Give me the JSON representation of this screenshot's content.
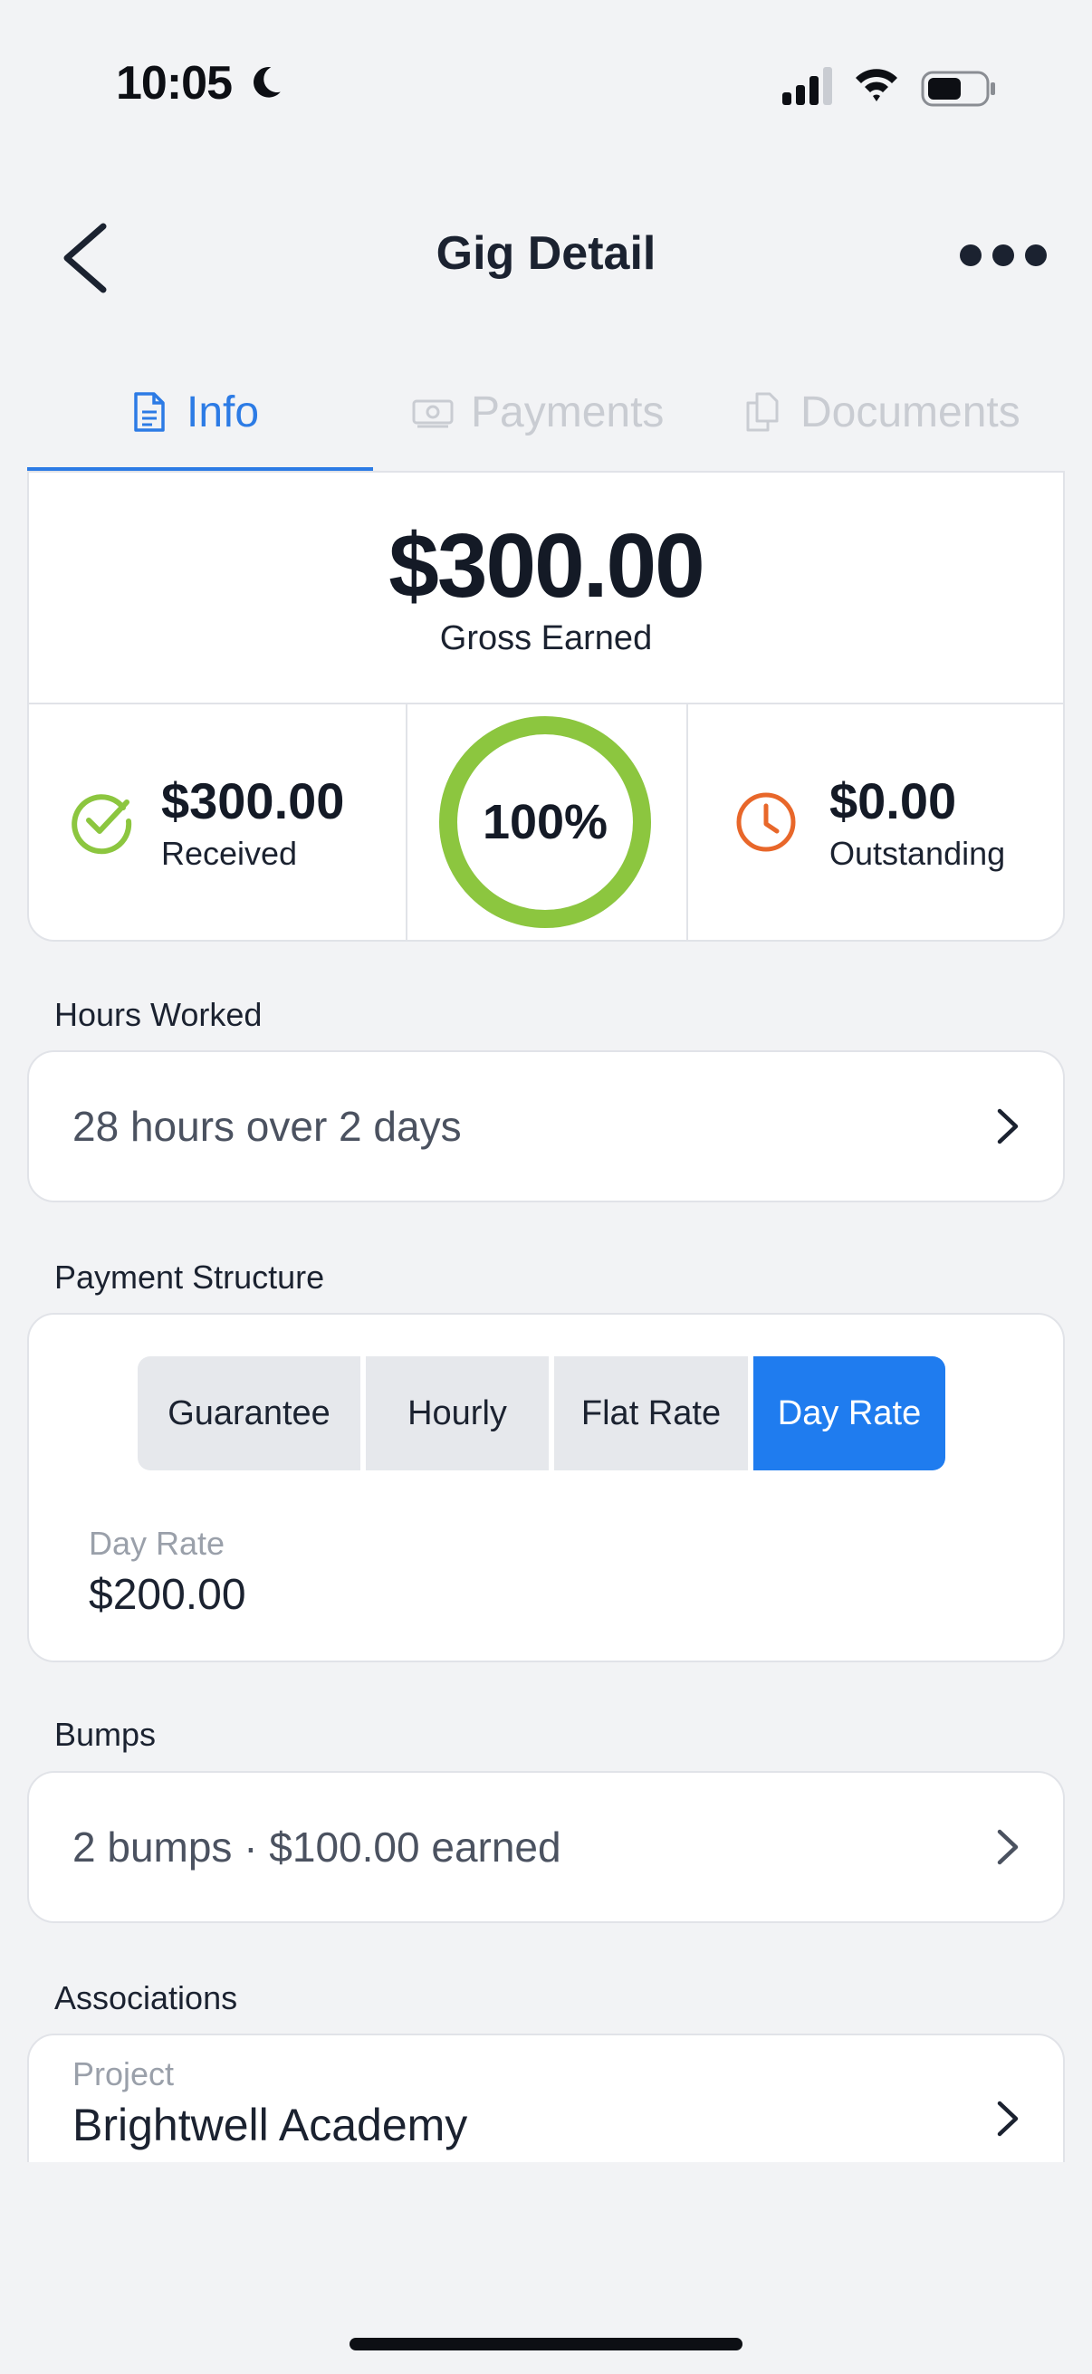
{
  "status_bar": {
    "time": "10:05"
  },
  "nav": {
    "title": "Gig Detail"
  },
  "tabs": [
    {
      "label": "Info",
      "active": true
    },
    {
      "label": "Payments",
      "active": false
    },
    {
      "label": "Documents",
      "active": false
    }
  ],
  "summary": {
    "gross_amount": "$300.00",
    "gross_label": "Gross Earned",
    "received_amount": "$300.00",
    "received_label": "Received",
    "progress_text": "100%",
    "progress_fraction": 1.0,
    "outstanding_amount": "$0.00",
    "outstanding_label": "Outstanding"
  },
  "hours": {
    "section_label": "Hours Worked",
    "value": "28 hours over 2 days"
  },
  "payment_structure": {
    "section_label": "Payment Structure",
    "options": [
      "Guarantee",
      "Hourly",
      "Flat Rate",
      "Day Rate"
    ],
    "selected": "Day Rate",
    "rate_label": "Day Rate",
    "rate_value": "$200.00"
  },
  "bumps": {
    "section_label": "Bumps",
    "value": "2 bumps · $100.00 earned"
  },
  "associations": {
    "section_label": "Associations",
    "project_label": "Project",
    "project_value": "Brightwell Academy"
  },
  "colors": {
    "accent": "#2c7be5",
    "segment_active": "#1f7cef",
    "success": "#8cc63f",
    "warning": "#e8672a"
  }
}
